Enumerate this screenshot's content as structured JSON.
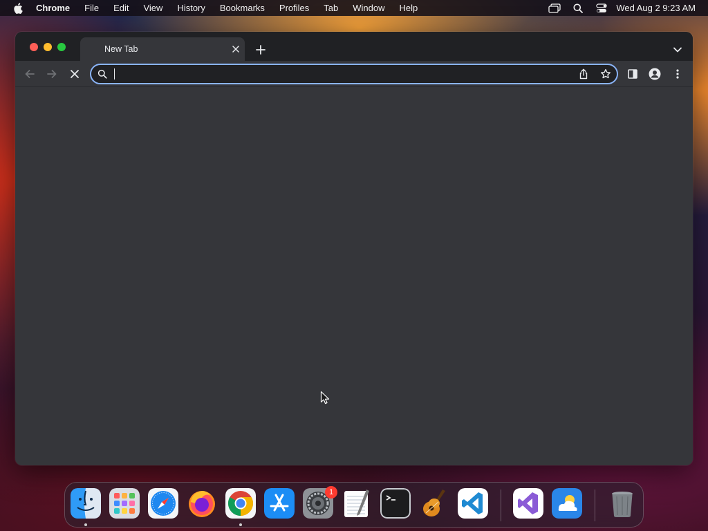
{
  "menubar": {
    "app_name": "Chrome",
    "items": [
      "File",
      "Edit",
      "View",
      "History",
      "Bookmarks",
      "Profiles",
      "Tab",
      "Window",
      "Help"
    ],
    "clock": "Wed Aug 2  9:23 AM",
    "status_icons": [
      "screen-mirroring-icon",
      "spotlight-search-icon",
      "control-center-icon"
    ]
  },
  "browser": {
    "tab_title": "New Tab",
    "omnibox": {
      "value": "",
      "placeholder": ""
    },
    "colors": {
      "frame": "#202124",
      "toolbar": "#35363a",
      "omnibox_focus": "#8ab4f8",
      "text": "#e8eaed"
    }
  },
  "dock": {
    "apps": [
      {
        "name": "Finder",
        "icon": "finder-icon",
        "running": true
      },
      {
        "name": "Launchpad",
        "icon": "launchpad-icon",
        "running": false
      },
      {
        "name": "Safari",
        "icon": "safari-icon",
        "running": false
      },
      {
        "name": "Firefox",
        "icon": "firefox-icon",
        "running": false
      },
      {
        "name": "Google Chrome",
        "icon": "chrome-icon",
        "running": true
      },
      {
        "name": "App Store",
        "icon": "app-store-icon",
        "running": false
      },
      {
        "name": "System Settings",
        "icon": "system-settings-icon",
        "running": false,
        "badge": "1"
      },
      {
        "name": "TextEdit",
        "icon": "textedit-icon",
        "running": false
      },
      {
        "name": "Terminal",
        "icon": "terminal-icon",
        "running": false
      },
      {
        "name": "GarageBand",
        "icon": "garageband-icon",
        "running": false
      },
      {
        "name": "Visual Studio Code",
        "icon": "vscode-icon",
        "running": false
      },
      {
        "name": "Visual Studio",
        "icon": "visual-studio-icon",
        "running": false
      },
      {
        "name": "Weather",
        "icon": "weather-icon",
        "running": false
      },
      {
        "name": "Trash",
        "icon": "trash-icon",
        "running": false
      }
    ]
  }
}
